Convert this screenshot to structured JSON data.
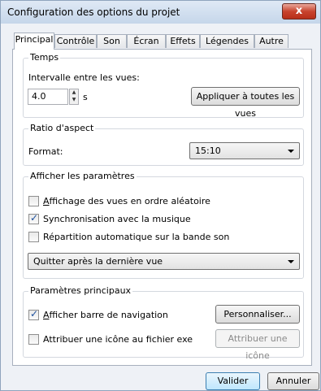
{
  "window": {
    "title": "Configuration des options du projet",
    "close_label": "x"
  },
  "tabs": [
    "Principal",
    "Contrôle",
    "Son",
    "Écran",
    "Effets",
    "Légendes",
    "Autre"
  ],
  "temps": {
    "group_label": "Temps",
    "interval_label": "Intervalle entre les vues:",
    "interval_value": "4.0",
    "unit": "s",
    "apply_all_button": "Appliquer à toutes les vues"
  },
  "aspect": {
    "group_label": "Ratio d'aspect",
    "format_label": "Format:",
    "format_value": "15:10"
  },
  "display": {
    "group_label": "Afficher les paramètres",
    "random_order": {
      "label_u": "A",
      "label_rest": "ffichage des vues en ordre aléatoire",
      "checked": false
    },
    "sync_music": {
      "label": "Synchronisation avec la musique",
      "checked": true
    },
    "auto_spread": {
      "label": "Répartition automatique sur la bande son",
      "checked": false
    },
    "end_action": "Quitter après la dernière vue"
  },
  "main_params": {
    "group_label": "Paramètres principaux",
    "show_nav": {
      "label_u": "A",
      "label_rest": "fficher barre de navigation",
      "checked": true
    },
    "customize_button": "Personnaliser...",
    "assign_icon": {
      "label": "Attribuer une icône au fichier exe",
      "checked": false
    },
    "assign_icon_button": "Attribuer une icône"
  },
  "footer": {
    "ok_button": "Valider",
    "cancel_button": "Annuler"
  }
}
